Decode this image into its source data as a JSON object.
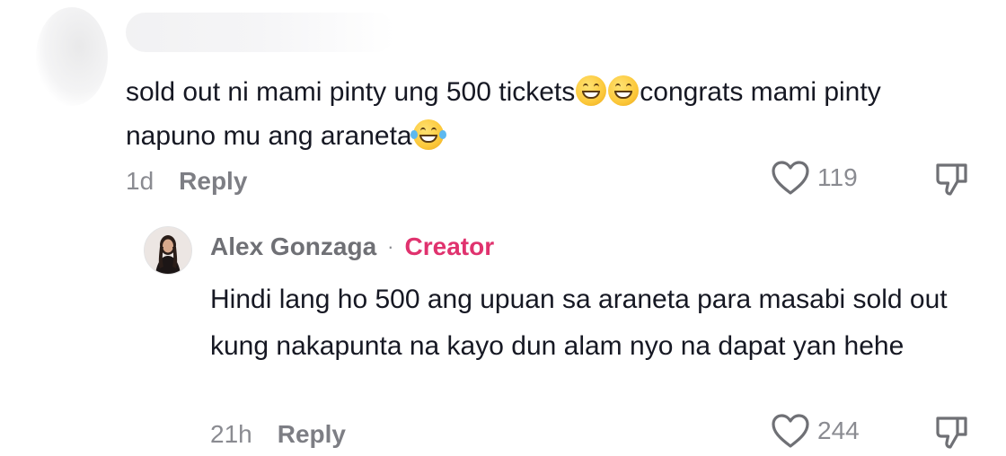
{
  "top_comment": {
    "text_part1": "sold out ni mami pinty ung 500 tickets",
    "text_part2": "congrats mami pinty napuno mu ang araneta",
    "emojis": [
      "grinning-face-emoji",
      "grinning-face-emoji",
      "face-with-tears-of-joy-emoji"
    ],
    "time": "1d",
    "reply_label": "Reply",
    "like_count": "119"
  },
  "reply_comment": {
    "author": "Alex Gonzaga",
    "separator": "·",
    "badge": "Creator",
    "text": "Hindi lang ho 500 ang upuan sa araneta para masabi sold out kung nakapunta na kayo dun alam nyo na dapat yan hehe",
    "time": "21h",
    "reply_label": "Reply",
    "like_count": "244"
  },
  "colors": {
    "text": "#161823",
    "muted": "#8a8b91",
    "creator_badge": "#e0326e"
  },
  "icons": {
    "like": "heart-outline-icon",
    "dislike": "thumbs-down-outline-icon"
  }
}
